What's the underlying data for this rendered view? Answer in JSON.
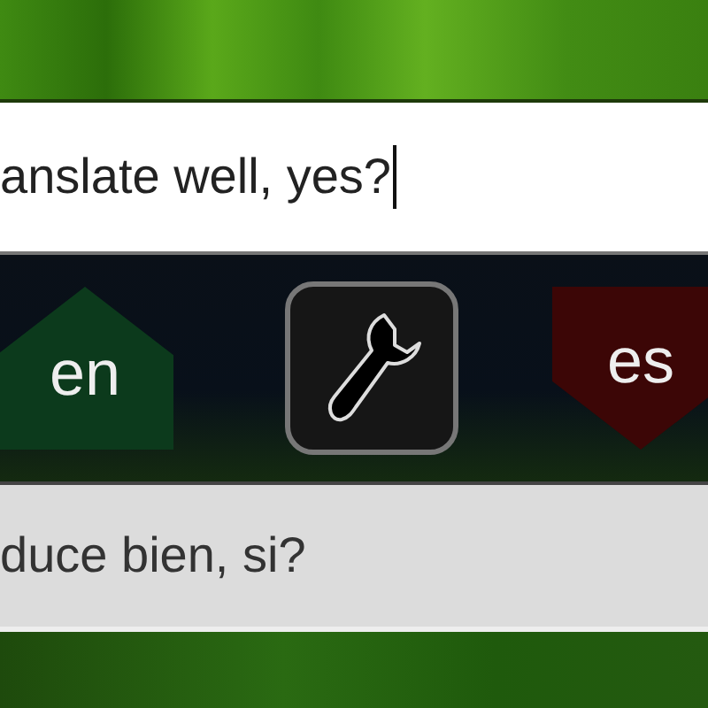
{
  "source_text": {
    "value": "anslate well, yes?"
  },
  "languages": [
    {
      "code": "en",
      "color": "#0c3a1c",
      "kind": "source"
    },
    {
      "code": "es",
      "color": "#3c0606",
      "kind": "target"
    }
  ],
  "translation": {
    "value": "duce bien, si?"
  }
}
